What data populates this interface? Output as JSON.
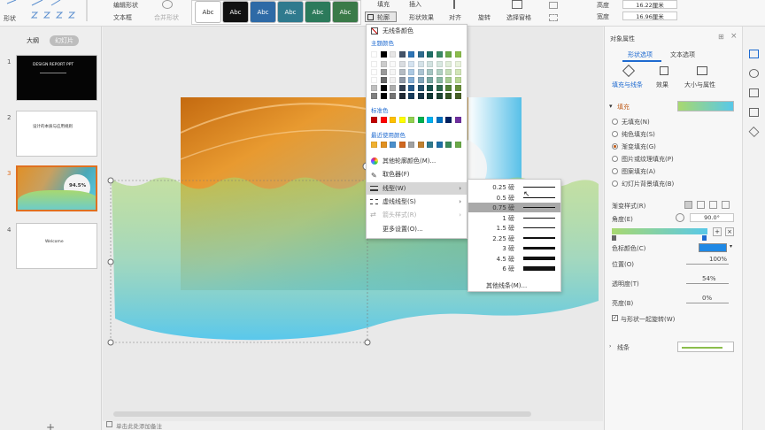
{
  "ribbon": {
    "shape_label": "形状",
    "edit_shape_label": "编辑形状",
    "textbox_label": "文本框",
    "merge_shape_label": "合并形状",
    "style_swatches": [
      {
        "label": "Abc",
        "bg": "#ffffff",
        "fg": "#333333"
      },
      {
        "label": "Abc",
        "bg": "#111111",
        "fg": "#ffffff"
      },
      {
        "label": "Abc",
        "bg": "#2e6aa6",
        "fg": "#ffffff"
      },
      {
        "label": "Abc",
        "bg": "#2f7a8e",
        "fg": "#ffffff"
      },
      {
        "label": "Abc",
        "bg": "#2c7a5b",
        "fg": "#ffffff"
      },
      {
        "label": "Abc",
        "bg": "#3a7a48",
        "fg": "#ffffff"
      }
    ],
    "fill_label": "填充",
    "outline_label": "轮廓",
    "insert_label": "插入",
    "shape_effect_label": "形状效果",
    "align_label": "对齐",
    "rotate_label": "旋转",
    "select_pane_label": "选择窗格",
    "height_label": "高度",
    "height_value": "16.22厘米",
    "width_label": "宽度",
    "width_value": "16.96厘米"
  },
  "left_panel": {
    "tab_outline": "大纲",
    "tab_slides": "幻灯片",
    "slides": [
      {
        "num": "1",
        "caption": "DESIGN REPORT PPT"
      },
      {
        "num": "2",
        "caption": "设计的本质与应用规则"
      },
      {
        "num": "3",
        "caption": "94.5%"
      },
      {
        "num": "4",
        "caption": "Welcome"
      }
    ]
  },
  "canvas": {
    "slide_percent": "94.5%"
  },
  "status": {
    "notes": "单击此处添加备注"
  },
  "outline_menu": {
    "no_outline": "无线条颜色",
    "theme_colors": "主题颜色",
    "standard_colors": "标准色",
    "recent_colors": "最近使用颜色",
    "more_colors": "其他轮廓颜色(M)...",
    "eyedropper": "取色器(F)",
    "line_weight": "线型(W)",
    "dash_type": "虚线线型(S)",
    "arrow_style": "箭头样式(R)",
    "more_settings": "更多设置(O)...",
    "theme_row": [
      "#ffffff",
      "#000000",
      "#e7e6e6",
      "#44546a",
      "#2e75b6",
      "#2f6c8e",
      "#1f6f66",
      "#3a8a66",
      "#6aaa48",
      "#8bbd4c"
    ],
    "standard_row": [
      "#c00000",
      "#ff0000",
      "#ffc000",
      "#ffff00",
      "#92d050",
      "#00b050",
      "#00b0f0",
      "#0070c0",
      "#002060",
      "#7030a0"
    ],
    "recent_row": [
      "#f0b030",
      "#e09020",
      "#4a8fcb",
      "#d06820",
      "#a0a0a0",
      "#c08030",
      "#2f7a8e",
      "#1f6fa6",
      "#3a8a58",
      "#6aaa48"
    ]
  },
  "weight_menu": {
    "items": [
      {
        "label": "0.25 磅",
        "pt": 0.25
      },
      {
        "label": "0.5 磅",
        "pt": 0.5
      },
      {
        "label": "0.75 磅",
        "pt": 0.75,
        "selected": true
      },
      {
        "label": "1 磅",
        "pt": 1
      },
      {
        "label": "1.5 磅",
        "pt": 1.5
      },
      {
        "label": "2.25 磅",
        "pt": 2.25
      },
      {
        "label": "3 磅",
        "pt": 3
      },
      {
        "label": "4.5 磅",
        "pt": 4.5
      },
      {
        "label": "6 磅",
        "pt": 6
      }
    ],
    "other_lines": "其他线条(M)..."
  },
  "object_panel": {
    "title": "对象属性",
    "tab_shape": "形状选项",
    "tab_text": "文本选项",
    "sub_fill_line": "填充与线条",
    "sub_effect": "效果",
    "sub_size": "大小与属性",
    "section_fill": "填充",
    "fill_options": [
      {
        "label": "无填充(N)",
        "checked": false
      },
      {
        "label": "纯色填充(S)",
        "checked": false
      },
      {
        "label": "渐变填充(G)",
        "checked": true
      },
      {
        "label": "图片或纹理填充(P)",
        "checked": false
      },
      {
        "label": "图案填充(A)",
        "checked": false
      },
      {
        "label": "幻灯片背景填充(B)",
        "checked": false
      }
    ],
    "gradient_style_label": "渐变样式(R)",
    "angle_label": "角度(E)",
    "angle_value": "90.0°",
    "color_label": "色标颜色(C)",
    "position_label": "位置(O)",
    "position_value": "100%",
    "transparency_label": "透明度(T)",
    "transparency_value": "54%",
    "brightness_label": "亮度(B)",
    "brightness_value": "0%",
    "rotate_with_shape": "与形状一起旋转(W)",
    "section_line": "线条",
    "accent_color": "#1e88e5"
  }
}
